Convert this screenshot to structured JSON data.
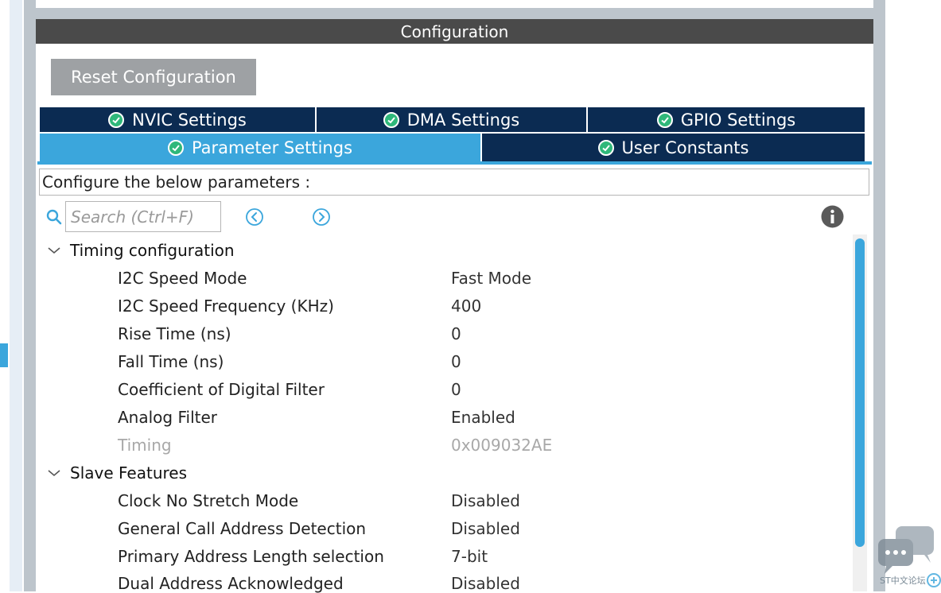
{
  "panel": {
    "title": "Configuration",
    "reset_label": "Reset Configuration"
  },
  "tabs": {
    "row1": [
      {
        "label": "NVIC Settings"
      },
      {
        "label": "DMA Settings"
      },
      {
        "label": "GPIO Settings"
      }
    ],
    "row2": [
      {
        "label": "Parameter Settings",
        "active": true
      },
      {
        "label": "User Constants"
      }
    ]
  },
  "description": "Configure the below parameters :",
  "search": {
    "placeholder": "Search (Ctrl+F)",
    "value": ""
  },
  "groups": [
    {
      "title": "Timing configuration",
      "params": [
        {
          "name": "I2C Speed Mode",
          "value": "Fast Mode"
        },
        {
          "name": "I2C Speed Frequency (KHz)",
          "value": "400"
        },
        {
          "name": "Rise Time (ns)",
          "value": "0"
        },
        {
          "name": "Fall Time (ns)",
          "value": "0"
        },
        {
          "name": "Coefficient of Digital Filter",
          "value": "0"
        },
        {
          "name": "Analog Filter",
          "value": "Enabled"
        },
        {
          "name": "Timing",
          "value": "0x009032AE",
          "disabled": true
        }
      ]
    },
    {
      "title": "Slave Features",
      "params": [
        {
          "name": "Clock No Stretch Mode",
          "value": "Disabled"
        },
        {
          "name": "General Call Address Detection",
          "value": "Disabled"
        },
        {
          "name": "Primary Address Length selection",
          "value": "7-bit"
        },
        {
          "name": "Dual Address Acknowledged",
          "value": "Disabled"
        }
      ]
    }
  ],
  "chat_widget": {
    "label": "ST中文论坛"
  },
  "colors": {
    "tab_dark": "#0b2b52",
    "tab_active": "#3ba6dc",
    "check_green": "#2fb87a",
    "header_gray": "#4a4a4a"
  }
}
